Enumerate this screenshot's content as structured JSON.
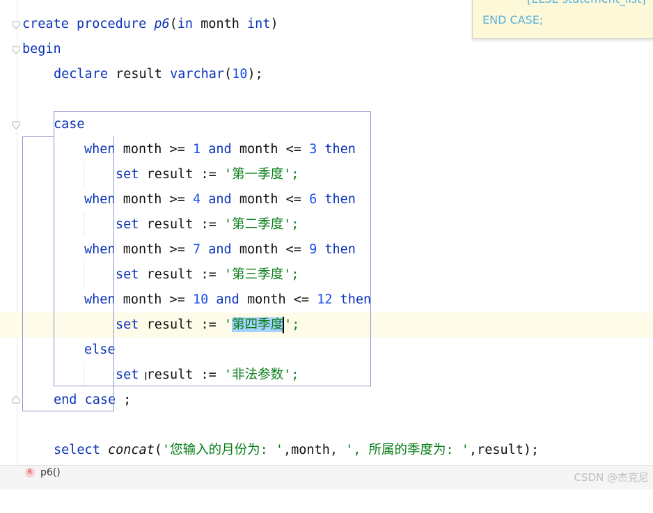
{
  "editor": {
    "lines": {
      "l1": {
        "create": "create",
        "procedure": "procedure",
        "name": "p6",
        "open": "(",
        "in": "in",
        "param": "month",
        "int": "int",
        "close": ")"
      },
      "l2": {
        "begin": "begin"
      },
      "l3": {
        "declare": "declare",
        "var": "result",
        "type": "varchar",
        "open": "(",
        "num": "10",
        "close": ");"
      },
      "l4": {
        "case": "case"
      },
      "when_rows": [
        {
          "when": "when",
          "v1": "month",
          "op1": ">=",
          "n1": "1",
          "and": "and",
          "v2": "month",
          "op2": "<=",
          "n2": "3",
          "then": "then"
        },
        {
          "when": "when",
          "v1": "month",
          "op1": ">=",
          "n1": "4",
          "and": "and",
          "v2": "month",
          "op2": "<=",
          "n2": "6",
          "then": "then"
        },
        {
          "when": "when",
          "v1": "month",
          "op1": ">=",
          "n1": "7",
          "and": "and",
          "v2": "month",
          "op2": "<=",
          "n2": "9",
          "then": "then"
        },
        {
          "when": "when",
          "v1": "month",
          "op1": ">=",
          "n1": "10",
          "and": "and",
          "v2": "month",
          "op2": "<=",
          "n2": "12",
          "then": "then"
        }
      ],
      "set_rows": [
        {
          "set": "set",
          "var": "result",
          "op": ":=",
          "q1": "'",
          "str": "第一季度",
          "q2": "';"
        },
        {
          "set": "set",
          "var": "result",
          "op": ":=",
          "q1": "'",
          "str": "第二季度",
          "q2": "';"
        },
        {
          "set": "set",
          "var": "result",
          "op": ":=",
          "q1": "'",
          "str": "第三季度",
          "q2": "';"
        },
        {
          "set": "set",
          "var": "result",
          "op": ":=",
          "q1": "'",
          "str": "第四季度",
          "q2": "';"
        }
      ],
      "else_row": {
        "else": "else"
      },
      "else_set": {
        "set": "set",
        "var": "result",
        "op": ":=",
        "q1": "'",
        "str": "非法参数",
        "q2": "';"
      },
      "end_row": {
        "end": "end",
        "case": "case",
        "semi": ";"
      },
      "select_row": {
        "select": "select",
        "fn": "concat",
        "open": "(",
        "s1": "'您输入的月份为: '",
        "c1": ",month, ",
        "s2": "', 所属的季度为: '",
        "c2": ",result);"
      }
    }
  },
  "tooltip": {
    "line1": "[ELSE statement_list]",
    "line2": "END CASE;"
  },
  "statusbar": {
    "badge": "R",
    "proc": "p6()"
  },
  "watermark": "CSDN @杰克尼"
}
